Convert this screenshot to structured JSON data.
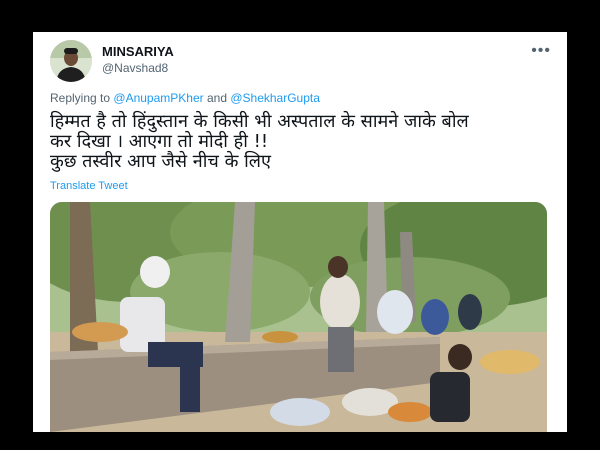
{
  "tweet": {
    "author_name": "MINSARIYA",
    "author_handle": "@Navshad8",
    "more_icon": "more-dots-icon",
    "reply_prefix": "Replying to",
    "reply_mention_1": "@AnupamPKher",
    "reply_and": "and",
    "reply_mention_2": "@ShekharGupta",
    "text_lines": [
      "हिम्मत है तो हिंदुस्तान के किसी भी अस्पताल के सामने जाके बोल",
      "कर दिखा । आएगा तो मोदी ही !!",
      "कुछ तस्वीर आप जैसे नीच के लिए"
    ],
    "translate_label": "Translate Tweet"
  },
  "colors": {
    "link": "#1d9bf0",
    "secondary_text": "#536471",
    "primary_text": "#0f1419"
  }
}
